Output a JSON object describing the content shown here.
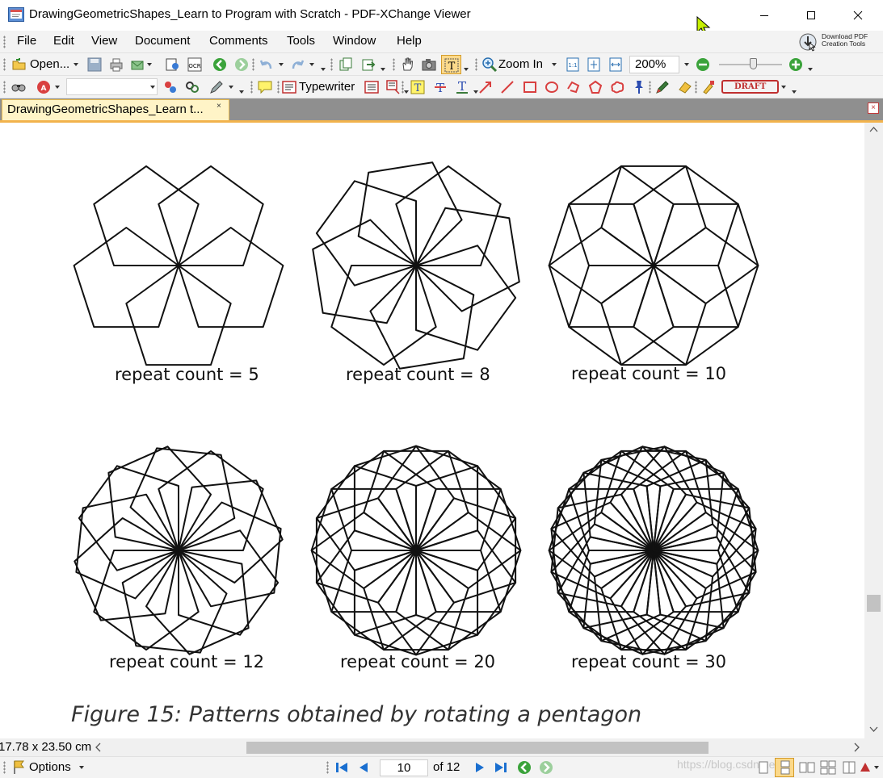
{
  "window": {
    "title": "DrawingGeometricShapes_Learn to Program with Scratch - PDF-XChange Viewer",
    "minimize_icon": "minimize-icon",
    "maximize_icon": "maximize-icon",
    "close_icon": "close-icon"
  },
  "menu": {
    "items": [
      "File",
      "Edit",
      "View",
      "Document",
      "Comments",
      "Tools",
      "Window",
      "Help"
    ],
    "download_line1": "Download PDF",
    "download_line2": "Creation Tools"
  },
  "toolbar1": {
    "open_label": "Open...",
    "zoom_in_label": "Zoom In",
    "zoom_value": "200%",
    "ocr_label": "OCR"
  },
  "toolbar2": {
    "typewriter_label": "Typewriter",
    "draft_label": "DRAFT",
    "font_name_value": ""
  },
  "tabs": {
    "active_label": "DrawingGeometricShapes_Learn t...",
    "close_glyph": "×"
  },
  "document": {
    "patterns": [
      {
        "label": "repeat count = 5",
        "count": 5
      },
      {
        "label": "repeat count = 8",
        "count": 8
      },
      {
        "label": "repeat count = 10",
        "count": 10
      },
      {
        "label": "repeat count = 12",
        "count": 12
      },
      {
        "label": "repeat count = 20",
        "count": 20
      },
      {
        "label": "repeat count = 30",
        "count": 30
      }
    ],
    "caption": "Figure 15: Patterns obtained by rotating a pentagon"
  },
  "scroll": {
    "page_size": "17.78 x 23.50 cm"
  },
  "statusbar": {
    "options_label": "Options",
    "current_page": "10",
    "page_total": "of 12",
    "watermark": "https://blog.csdn.net/..."
  },
  "colors": {
    "accent_tab": "#fff4c7",
    "tab_border": "#f2b34c",
    "nav_blue": "#1a6fd0",
    "nav_green": "#3ba33b"
  }
}
